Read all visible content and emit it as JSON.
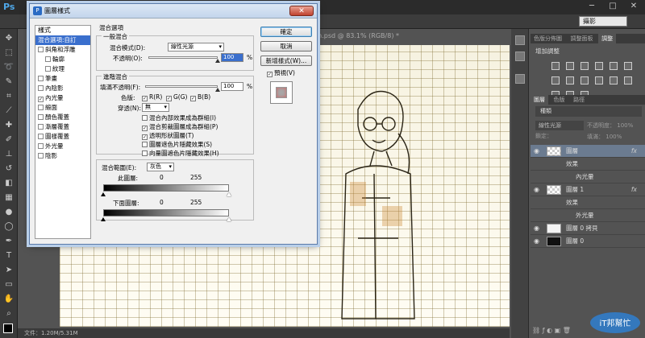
{
  "app": {
    "logo": "Ps",
    "workspace": "攝影",
    "doc_tab": "01_n.psd @ 83.1% (RGB/8) *",
    "status": "文件：1.20M/5.31M",
    "minimize": "─",
    "maximize": "□",
    "close": "✕"
  },
  "right_panels": {
    "tabs_top": [
      "色版分佈圖",
      "調整面板",
      "調整"
    ],
    "adjust_title": "增加調整",
    "layers_tabs": [
      "圖層",
      "色版",
      "路徑"
    ],
    "filter_kind": "種類",
    "blend_mode": "線性光源",
    "opacity_label": "不透明度：",
    "opacity_value": "100%",
    "fill_label": "填滿：",
    "fill_value": "100%",
    "lock_label": "鎖定：",
    "layers": [
      {
        "name": "圖層",
        "fx": "fx",
        "selected": true
      },
      {
        "name": "效果",
        "sub": 1
      },
      {
        "name": "內光暈",
        "sub": 2
      },
      {
        "name": "圖層 1",
        "fx": "fx"
      },
      {
        "name": "效果",
        "sub": 1
      },
      {
        "name": "外光暈",
        "sub": 2
      },
      {
        "name": "圖層 0 拷貝"
      },
      {
        "name": "圖層 0"
      }
    ]
  },
  "dialog": {
    "title": "圖層樣式",
    "close": "✕",
    "styles_header": "樣式",
    "style_items": [
      {
        "label": "混合選項:自訂",
        "selected": true,
        "checkbox": false
      },
      {
        "label": "斜角和浮雕",
        "checkbox": true,
        "checked": false
      },
      {
        "label": "輪廓",
        "checkbox": true,
        "checked": false,
        "indent": true
      },
      {
        "label": "紋理",
        "checkbox": true,
        "checked": false,
        "indent": true
      },
      {
        "label": "筆畫",
        "checkbox": true,
        "checked": false
      },
      {
        "label": "內陰影",
        "checkbox": true,
        "checked": false
      },
      {
        "label": "內光暈",
        "checkbox": true,
        "checked": true
      },
      {
        "label": "緞面",
        "checkbox": true,
        "checked": false
      },
      {
        "label": "顏色覆蓋",
        "checkbox": true,
        "checked": false
      },
      {
        "label": "漸層覆蓋",
        "checkbox": true,
        "checked": false
      },
      {
        "label": "圖樣覆蓋",
        "checkbox": true,
        "checked": false
      },
      {
        "label": "外光暈",
        "checkbox": true,
        "checked": false
      },
      {
        "label": "陰影",
        "checkbox": true,
        "checked": false
      }
    ],
    "blending_options_title": "混合選項",
    "general_blending": "一般混合",
    "blend_mode_label": "混合模式(D):",
    "blend_mode_value": "線性光源",
    "opacity_label": "不透明(O):",
    "opacity_value": "100",
    "percent": "%",
    "advanced_blending": "進階混合",
    "fill_opacity_label": "填滿不透明(F):",
    "fill_opacity_value": "100",
    "channels_label": "色版:",
    "channels": [
      {
        "label": "R(R)",
        "checked": true
      },
      {
        "label": "G(G)",
        "checked": true
      },
      {
        "label": "B(B)",
        "checked": true
      }
    ],
    "knockout_label": "穿透(N):",
    "knockout_value": "無",
    "options": [
      {
        "label": "混合內部效果成為群組(I)",
        "checked": false
      },
      {
        "label": "混合剪裁圖層成為群組(P)",
        "checked": true
      },
      {
        "label": "透明形狀圖層(T)",
        "checked": true
      },
      {
        "label": "圖層遮色片隱藏效果(S)",
        "checked": false
      },
      {
        "label": "向量圖遮色片隱藏效果(H)",
        "checked": false
      }
    ],
    "blend_if_label": "混合範圍(E):",
    "blend_if_value": "灰色",
    "this_layer_label": "此圖層:",
    "this_layer_min": "0",
    "this_layer_max": "255",
    "underlying_label": "下面圖層:",
    "underlying_min": "0",
    "underlying_max": "255",
    "buttons": {
      "ok": "確定",
      "cancel": "取消",
      "new_style": "新增樣式(W)...",
      "preview": "預視(V)"
    },
    "preview_checked": true
  },
  "watermark": "iT邦幫忙"
}
